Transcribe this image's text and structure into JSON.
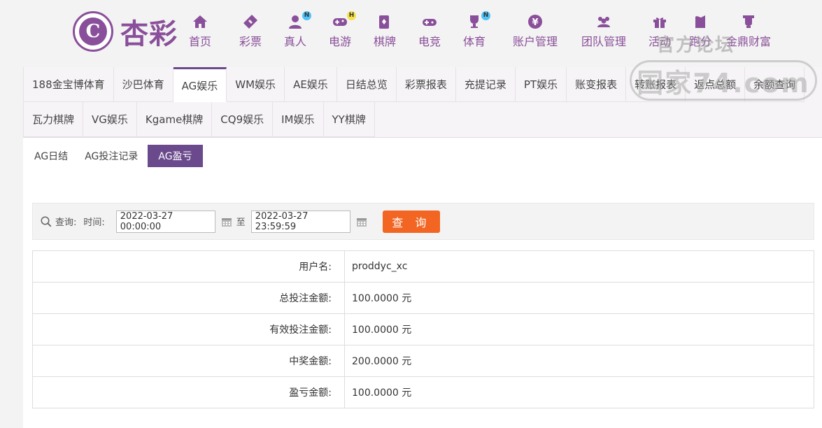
{
  "logo": {
    "mark": "C",
    "text": "杏彩"
  },
  "nav": [
    {
      "label": "首页",
      "icon": "home-icon"
    },
    {
      "label": "彩票",
      "icon": "ticket-icon"
    },
    {
      "label": "真人",
      "icon": "dealer-icon",
      "badge": "N"
    },
    {
      "label": "电游",
      "icon": "gamepad-icon",
      "badge": "H"
    },
    {
      "label": "棋牌",
      "icon": "cards-icon"
    },
    {
      "label": "电竞",
      "icon": "controller-icon"
    },
    {
      "label": "体育",
      "icon": "trophy-icon",
      "badge": "N"
    },
    {
      "label": "账户管理",
      "icon": "yen-icon"
    },
    {
      "label": "团队管理",
      "icon": "team-icon"
    },
    {
      "label": "活动",
      "icon": "gift-icon"
    },
    {
      "label": "跑分",
      "icon": "run-icon"
    },
    {
      "label": "金鼎财富",
      "icon": "wealth-icon"
    }
  ],
  "watermark": {
    "top": "官方论坛",
    "box": "国家74.com"
  },
  "tabs_row1": [
    "188金宝博体育",
    "沙巴体育",
    "AG娱乐",
    "WM娱乐",
    "AE娱乐",
    "日结总览",
    "彩票报表",
    "充提记录",
    "PT娱乐",
    "账变报表",
    "转账报表",
    "返点总额",
    "余额查询"
  ],
  "tabs_row2": [
    "瓦力棋牌",
    "VG娱乐",
    "Kgame棋牌",
    "CQ9娱乐",
    "IM娱乐",
    "YY棋牌"
  ],
  "active_tab": "AG娱乐",
  "subtabs": [
    "AG日结",
    "AG投注记录",
    "AG盈亏"
  ],
  "active_subtab": "AG盈亏",
  "search": {
    "query_label": "查询:",
    "time_label": "时间:",
    "start": "2022-03-27 00:00:00",
    "to_label": "至",
    "end": "2022-03-27 23:59:59",
    "button": "查 询"
  },
  "results": [
    {
      "key": "用户名:",
      "value": "proddyc_xc"
    },
    {
      "key": "总投注金额:",
      "value": "100.0000 元"
    },
    {
      "key": "有效投注金额:",
      "value": "100.0000 元"
    },
    {
      "key": "中奖金额:",
      "value": "200.0000 元"
    },
    {
      "key": "盈亏金额:",
      "value": "100.0000 元"
    }
  ],
  "colors": {
    "brand": "#8a4f9a",
    "active": "#6a4a8c",
    "button": "#f26522"
  }
}
